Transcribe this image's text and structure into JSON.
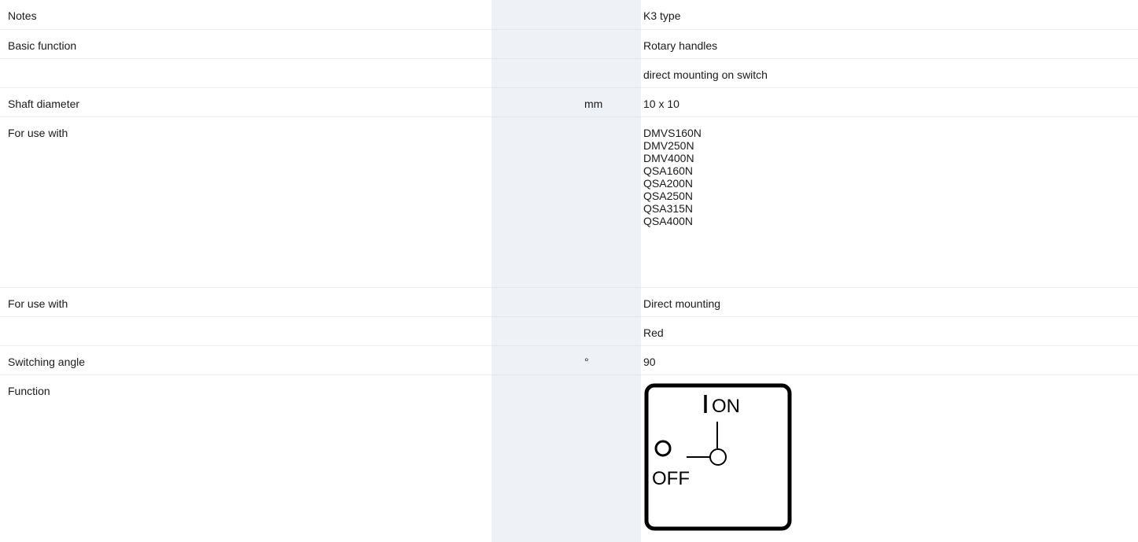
{
  "rows": [
    {
      "label": "Notes",
      "unit": "",
      "value": "K3 type"
    },
    {
      "label": "Basic function",
      "unit": "",
      "value": "Rotary handles"
    },
    {
      "label": "",
      "unit": "",
      "value": "direct mounting on switch"
    },
    {
      "label": "Shaft diameter",
      "unit": "mm",
      "value": "10 x 10"
    },
    {
      "label": "For use with",
      "unit": "",
      "values": [
        "DMVS160N",
        "DMV250N",
        "DMV400N",
        "QSA160N",
        "QSA200N",
        "QSA250N",
        "QSA315N",
        "QSA400N"
      ]
    },
    {
      "label": "For use with",
      "unit": "",
      "value": "Direct mounting"
    },
    {
      "label": "",
      "unit": "",
      "value": "Red"
    },
    {
      "label": "Switching angle",
      "unit": "°",
      "value": "90"
    },
    {
      "label": "Function",
      "unit": "",
      "diagram": {
        "on_label": "ON",
        "off_label": "OFF"
      }
    }
  ],
  "colors": {
    "unit_column_bg": "#eef1f5",
    "row_divider": "#ebeef2",
    "diagram_stroke": "#000000"
  }
}
